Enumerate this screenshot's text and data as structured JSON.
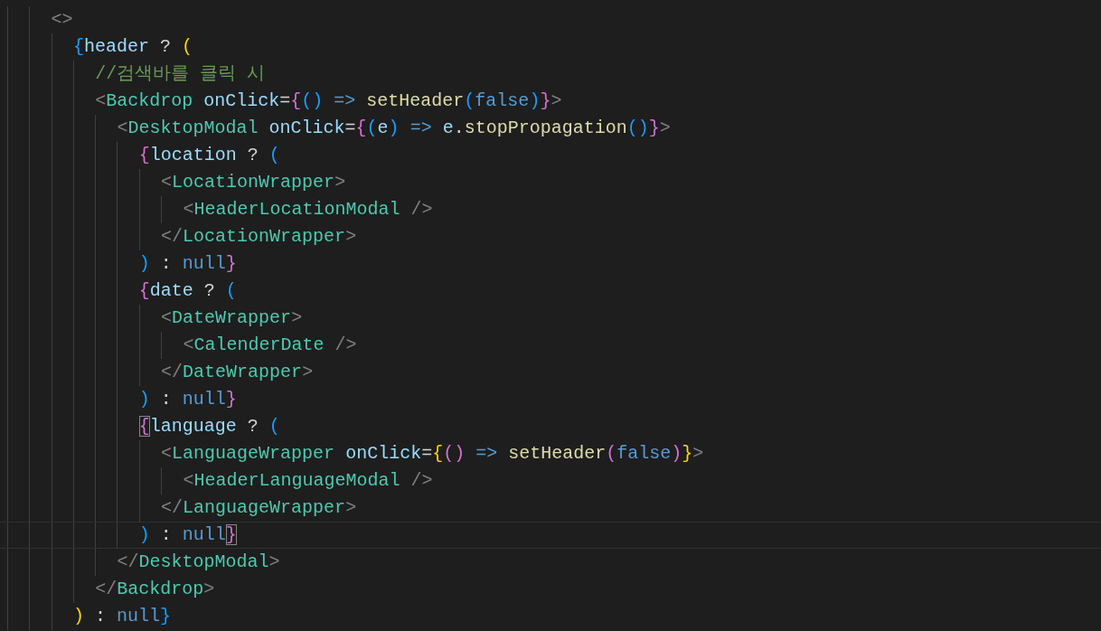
{
  "editor": {
    "lines": [
      {
        "tokens": [
          {
            "text": "<>",
            "kind": "punct"
          }
        ],
        "children": [
          {
            "tokens": [
              {
                "text": "{",
                "kind": "bracket3"
              },
              {
                "text": "header",
                "kind": "var"
              },
              {
                "text": " ? ",
                "kind": "op"
              },
              {
                "text": "(",
                "kind": "bracket1"
              }
            ],
            "children": [
              {
                "tokens": [
                  {
                    "text": "//검색바를 클릭 시",
                    "kind": "comment"
                  }
                ]
              },
              {
                "tokens": [
                  {
                    "text": "<",
                    "kind": "punct"
                  },
                  {
                    "text": "Backdrop ",
                    "kind": "tag"
                  },
                  {
                    "text": "onClick",
                    "kind": "attr"
                  },
                  {
                    "text": "=",
                    "kind": "op"
                  },
                  {
                    "text": "{",
                    "kind": "bracket2"
                  },
                  {
                    "text": "()",
                    "kind": "bracket3"
                  },
                  {
                    "text": " => ",
                    "kind": "keyword"
                  },
                  {
                    "text": "setHeader",
                    "kind": "function"
                  },
                  {
                    "text": "(",
                    "kind": "bracket3"
                  },
                  {
                    "text": "false",
                    "kind": "keyword"
                  },
                  {
                    "text": ")",
                    "kind": "bracket3"
                  },
                  {
                    "text": "}",
                    "kind": "bracket2"
                  },
                  {
                    "text": ">",
                    "kind": "punct"
                  }
                ],
                "children": [
                  {
                    "tokens": [
                      {
                        "text": "<",
                        "kind": "punct"
                      },
                      {
                        "text": "DesktopModal ",
                        "kind": "tag"
                      },
                      {
                        "text": "onClick",
                        "kind": "attr"
                      },
                      {
                        "text": "=",
                        "kind": "op"
                      },
                      {
                        "text": "{",
                        "kind": "bracket2"
                      },
                      {
                        "text": "(",
                        "kind": "bracket3"
                      },
                      {
                        "text": "e",
                        "kind": "var"
                      },
                      {
                        "text": ")",
                        "kind": "bracket3"
                      },
                      {
                        "text": " => ",
                        "kind": "keyword"
                      },
                      {
                        "text": "e",
                        "kind": "var"
                      },
                      {
                        "text": ".",
                        "kind": "op"
                      },
                      {
                        "text": "stopPropagation",
                        "kind": "function"
                      },
                      {
                        "text": "()",
                        "kind": "bracket3"
                      },
                      {
                        "text": "}",
                        "kind": "bracket2"
                      },
                      {
                        "text": ">",
                        "kind": "punct"
                      }
                    ],
                    "children": [
                      {
                        "tokens": [
                          {
                            "text": "{",
                            "kind": "bracket2"
                          },
                          {
                            "text": "location",
                            "kind": "var"
                          },
                          {
                            "text": " ? ",
                            "kind": "op"
                          },
                          {
                            "text": "(",
                            "kind": "bracket3"
                          }
                        ],
                        "children": [
                          {
                            "tokens": [
                              {
                                "text": "<",
                                "kind": "punct"
                              },
                              {
                                "text": "LocationWrapper",
                                "kind": "tag"
                              },
                              {
                                "text": ">",
                                "kind": "punct"
                              }
                            ],
                            "children": [
                              {
                                "tokens": [
                                  {
                                    "text": "<",
                                    "kind": "punct"
                                  },
                                  {
                                    "text": "HeaderLocationModal",
                                    "kind": "tag"
                                  },
                                  {
                                    "text": " />",
                                    "kind": "punct"
                                  }
                                ]
                              }
                            ]
                          },
                          {
                            "tokens": [
                              {
                                "text": "</",
                                "kind": "punct"
                              },
                              {
                                "text": "LocationWrapper",
                                "kind": "tag"
                              },
                              {
                                "text": ">",
                                "kind": "punct"
                              }
                            ]
                          }
                        ]
                      },
                      {
                        "tokens": [
                          {
                            "text": ")",
                            "kind": "bracket3"
                          },
                          {
                            "text": " : ",
                            "kind": "op"
                          },
                          {
                            "text": "null",
                            "kind": "keyword"
                          },
                          {
                            "text": "}",
                            "kind": "bracket2"
                          }
                        ]
                      },
                      {
                        "tokens": [
                          {
                            "text": "{",
                            "kind": "bracket2"
                          },
                          {
                            "text": "date",
                            "kind": "var"
                          },
                          {
                            "text": " ? ",
                            "kind": "op"
                          },
                          {
                            "text": "(",
                            "kind": "bracket3"
                          }
                        ],
                        "children": [
                          {
                            "tokens": [
                              {
                                "text": "<",
                                "kind": "punct"
                              },
                              {
                                "text": "DateWrapper",
                                "kind": "tag"
                              },
                              {
                                "text": ">",
                                "kind": "punct"
                              }
                            ],
                            "children": [
                              {
                                "tokens": [
                                  {
                                    "text": "<",
                                    "kind": "punct"
                                  },
                                  {
                                    "text": "CalenderDate",
                                    "kind": "tag"
                                  },
                                  {
                                    "text": " />",
                                    "kind": "punct"
                                  }
                                ]
                              }
                            ]
                          },
                          {
                            "tokens": [
                              {
                                "text": "</",
                                "kind": "punct"
                              },
                              {
                                "text": "DateWrapper",
                                "kind": "tag"
                              },
                              {
                                "text": ">",
                                "kind": "punct"
                              }
                            ]
                          }
                        ]
                      },
                      {
                        "tokens": [
                          {
                            "text": ")",
                            "kind": "bracket3"
                          },
                          {
                            "text": " : ",
                            "kind": "op"
                          },
                          {
                            "text": "null",
                            "kind": "keyword"
                          },
                          {
                            "text": "}",
                            "kind": "bracket2"
                          }
                        ]
                      },
                      {
                        "tokens": [
                          {
                            "text": "{",
                            "kind": "bracket2",
                            "matched": true
                          },
                          {
                            "text": "language",
                            "kind": "var"
                          },
                          {
                            "text": " ? ",
                            "kind": "op"
                          },
                          {
                            "text": "(",
                            "kind": "bracket3"
                          }
                        ],
                        "children": [
                          {
                            "tokens": [
                              {
                                "text": "<",
                                "kind": "punct"
                              },
                              {
                                "text": "LanguageWrapper ",
                                "kind": "tag"
                              },
                              {
                                "text": "onClick",
                                "kind": "attr"
                              },
                              {
                                "text": "=",
                                "kind": "op"
                              },
                              {
                                "text": "{",
                                "kind": "bracket1"
                              },
                              {
                                "text": "()",
                                "kind": "bracket2"
                              },
                              {
                                "text": " => ",
                                "kind": "keyword"
                              },
                              {
                                "text": "setHeader",
                                "kind": "function"
                              },
                              {
                                "text": "(",
                                "kind": "bracket2"
                              },
                              {
                                "text": "false",
                                "kind": "keyword"
                              },
                              {
                                "text": ")",
                                "kind": "bracket2"
                              },
                              {
                                "text": "}",
                                "kind": "bracket1"
                              },
                              {
                                "text": ">",
                                "kind": "punct"
                              }
                            ],
                            "children": [
                              {
                                "tokens": [
                                  {
                                    "text": "<",
                                    "kind": "punct"
                                  },
                                  {
                                    "text": "HeaderLanguageModal",
                                    "kind": "tag"
                                  },
                                  {
                                    "text": " />",
                                    "kind": "punct"
                                  }
                                ]
                              }
                            ]
                          },
                          {
                            "tokens": [
                              {
                                "text": "</",
                                "kind": "punct"
                              },
                              {
                                "text": "LanguageWrapper",
                                "kind": "tag"
                              },
                              {
                                "text": ">",
                                "kind": "punct"
                              }
                            ]
                          }
                        ]
                      },
                      {
                        "current": true,
                        "tokens": [
                          {
                            "text": ")",
                            "kind": "bracket3"
                          },
                          {
                            "text": " : ",
                            "kind": "op"
                          },
                          {
                            "text": "null",
                            "kind": "keyword"
                          },
                          {
                            "text": "}",
                            "kind": "bracket2",
                            "matched": true
                          }
                        ]
                      }
                    ]
                  },
                  {
                    "tokens": [
                      {
                        "text": "</",
                        "kind": "punct"
                      },
                      {
                        "text": "DesktopModal",
                        "kind": "tag"
                      },
                      {
                        "text": ">",
                        "kind": "punct"
                      }
                    ]
                  }
                ]
              },
              {
                "tokens": [
                  {
                    "text": "</",
                    "kind": "punct"
                  },
                  {
                    "text": "Backdrop",
                    "kind": "tag"
                  },
                  {
                    "text": ">",
                    "kind": "punct"
                  }
                ]
              }
            ]
          },
          {
            "tokens": [
              {
                "text": ")",
                "kind": "bracket1"
              },
              {
                "text": " : ",
                "kind": "op"
              },
              {
                "text": "null",
                "kind": "keyword"
              },
              {
                "text": "}",
                "kind": "bracket3"
              }
            ]
          }
        ]
      }
    ]
  }
}
